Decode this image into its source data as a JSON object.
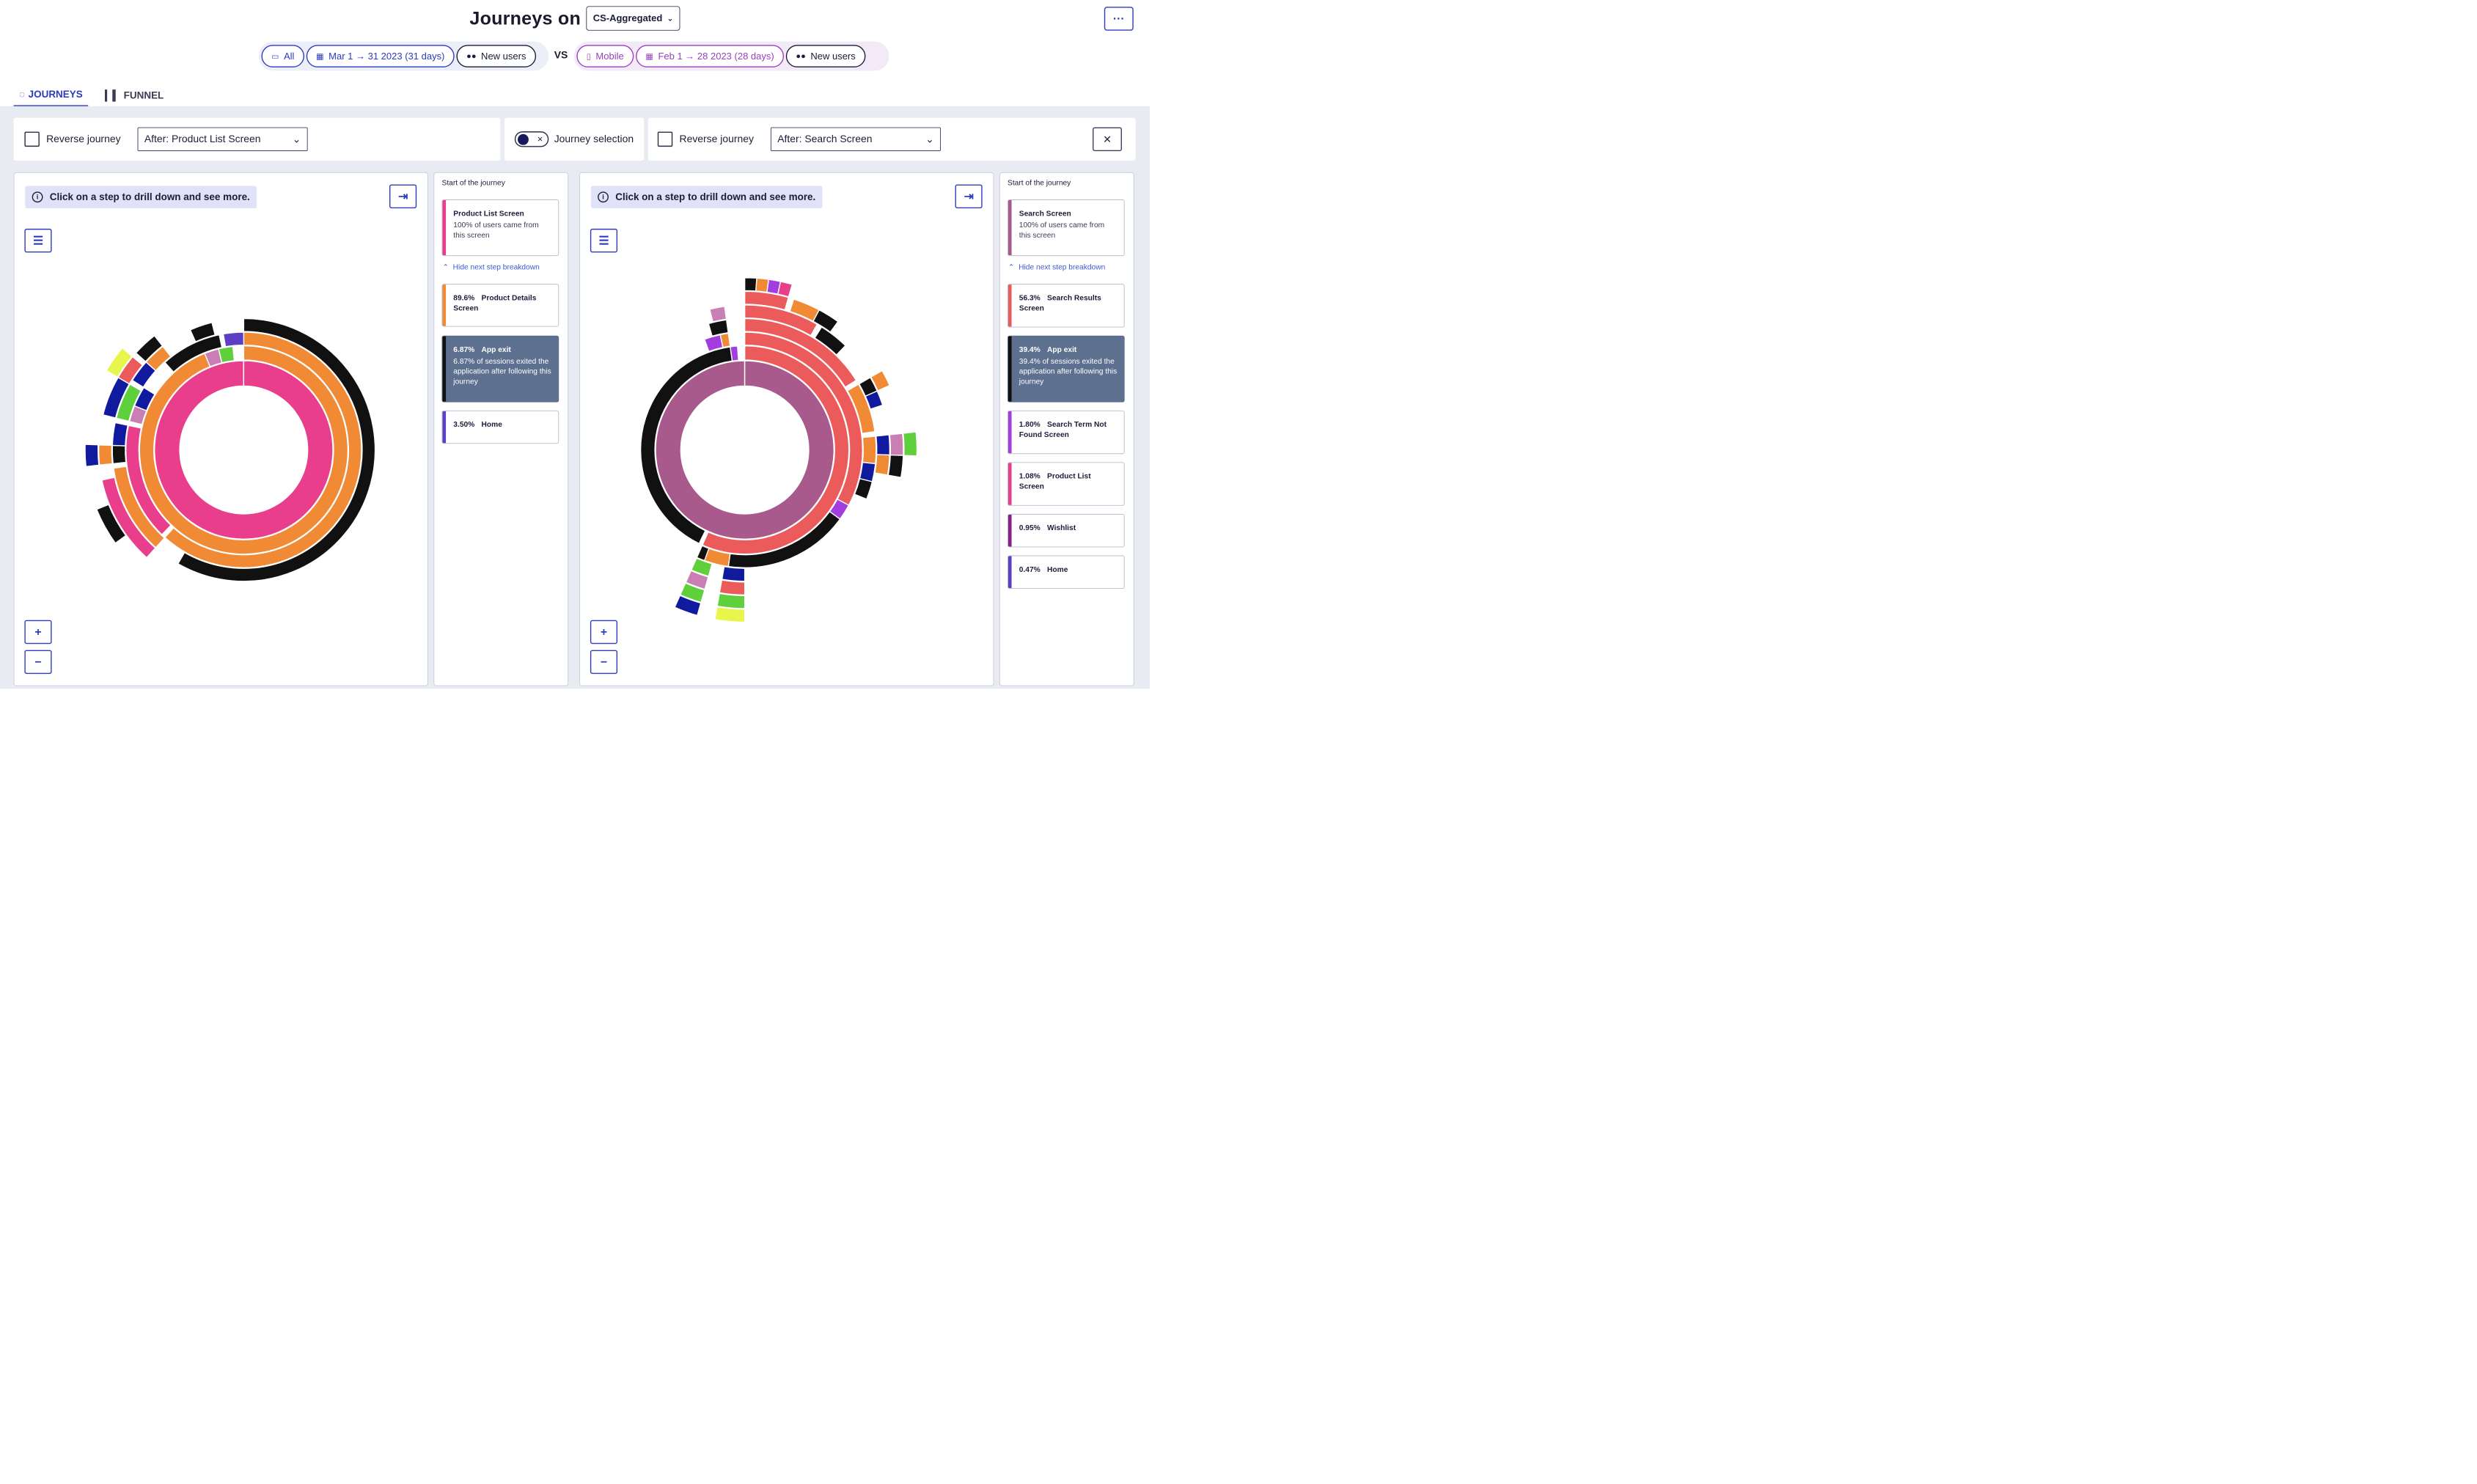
{
  "header": {
    "title": "Journeys on",
    "workspace": "CS-Aggregated",
    "more": "···"
  },
  "comparison": {
    "a": {
      "platform": "All",
      "date_range": "Mar 1 → 31 2023 (31 days)",
      "audience": "New users"
    },
    "vs": "VS",
    "b": {
      "platform": "Mobile",
      "date_range": "Feb 1 → 28 2023 (28 days)",
      "audience": "New users"
    }
  },
  "tabs": [
    {
      "label": "JOURNEYS",
      "icon": "ring-icon",
      "active": true
    },
    {
      "label": "FUNNEL",
      "icon": "bar-chart-icon",
      "active": false
    }
  ],
  "controls": {
    "left": {
      "reverse_label": "Reverse journey",
      "step": "After: Product List Screen"
    },
    "journey_selection": {
      "label": "Journey selection",
      "enabled": true
    },
    "right": {
      "reverse_label": "Reverse journey",
      "step": "After: Search Screen"
    }
  },
  "left": {
    "hint": "Click on a step to drill down and see more.",
    "breakdown_title": "Start of the journey",
    "start": {
      "name": "Product List Screen",
      "desc": "100% of users came from this screen",
      "color": "#e83e8c"
    },
    "toggle_label": "Hide next step breakdown",
    "steps": [
      {
        "pct": "89.6%",
        "name": "Product Details Screen",
        "desc": "",
        "color": "#f08a34",
        "dark": false
      },
      {
        "pct": "6.87%",
        "name": "App exit",
        "desc": "6.87% of sessions exited the application after following this journey",
        "color": "#111111",
        "dark": true
      },
      {
        "pct": "3.50%",
        "name": "Home",
        "desc": "",
        "color": "#5b3fc4",
        "dark": false
      }
    ]
  },
  "right": {
    "hint": "Click on a step to drill down and see more.",
    "breakdown_title": "Start of the journey",
    "start": {
      "name": "Search Screen",
      "desc": "100% of users came from this screen",
      "color": "#a85a8c"
    },
    "toggle_label": "Hide next step breakdown",
    "steps": [
      {
        "pct": "56.3%",
        "name": "Search Results Screen",
        "desc": "",
        "color": "#ec5b5b",
        "dark": false
      },
      {
        "pct": "39.4%",
        "name": "App exit",
        "desc": "39.4% of sessions exited the application after following this journey",
        "color": "#111111",
        "dark": true
      },
      {
        "pct": "1.80%",
        "name": "Search Term Not Found Screen",
        "desc": "",
        "color": "#a23ee0",
        "dark": false
      },
      {
        "pct": "1.08%",
        "name": "Product List Screen",
        "desc": "",
        "color": "#e83e8c",
        "dark": false
      },
      {
        "pct": "0.95%",
        "name": "Wishlist",
        "desc": "",
        "color": "#8a1e8a",
        "dark": false
      },
      {
        "pct": "0.47%",
        "name": "Home",
        "desc": "",
        "color": "#5b3fc4",
        "dark": false
      }
    ]
  },
  "colors": {
    "accent": "#2c3bbf",
    "compare_b": "#9a3fc0",
    "product_list": "#e83e8c",
    "product_details": "#f08a34",
    "search_screen": "#a85a8c",
    "search_results": "#ec5b5b",
    "exit": "#111111",
    "home": "#5b3fc4",
    "navy": "#101a9e",
    "green": "#5fd03c",
    "lime": "#e8f54a",
    "mauve": "#c97fb4",
    "violet": "#a23ee0"
  }
}
